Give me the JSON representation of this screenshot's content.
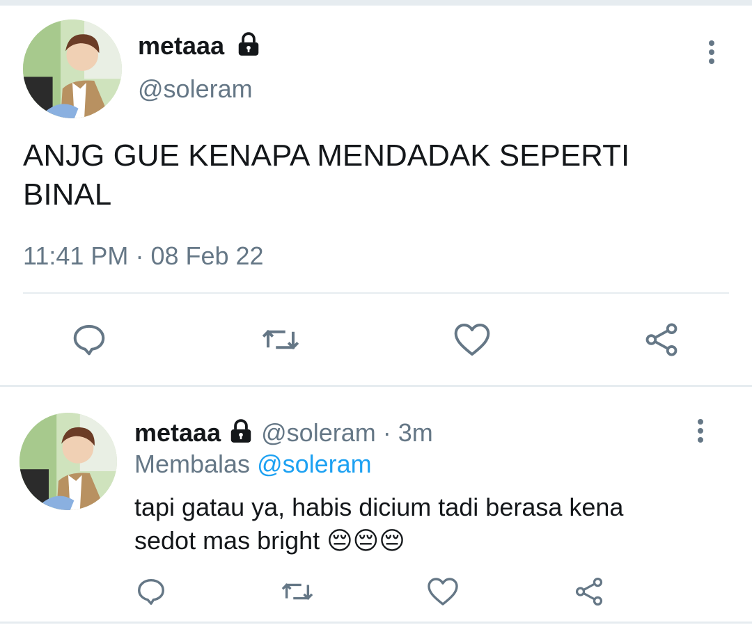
{
  "main_tweet": {
    "display_name": "metaaa",
    "handle": "@soleram",
    "text": "ANJG GUE KENAPA MENDADAK SEPERTI BINAL",
    "time": "11:41 PM",
    "dot": "·",
    "date": "08 Feb 22"
  },
  "reply": {
    "display_name": "metaaa",
    "handle": "@soleram",
    "separator": "·",
    "age": "3m",
    "replying_prefix": "Membalas",
    "replying_to": "@soleram",
    "text": "tapi gatau ya, habis dicium tadi berasa kena sedot mas bright 😔😔😔"
  },
  "icons": {
    "lock": "lock-icon",
    "more": "more-vertical-icon",
    "reply": "reply-bubble-icon",
    "retweet": "retweet-icon",
    "like": "heart-icon",
    "share": "share-icon"
  },
  "colors": {
    "text": "#14171a",
    "secondary": "#657786",
    "accent": "#1da1f2",
    "divider": "#e6ecf0"
  }
}
